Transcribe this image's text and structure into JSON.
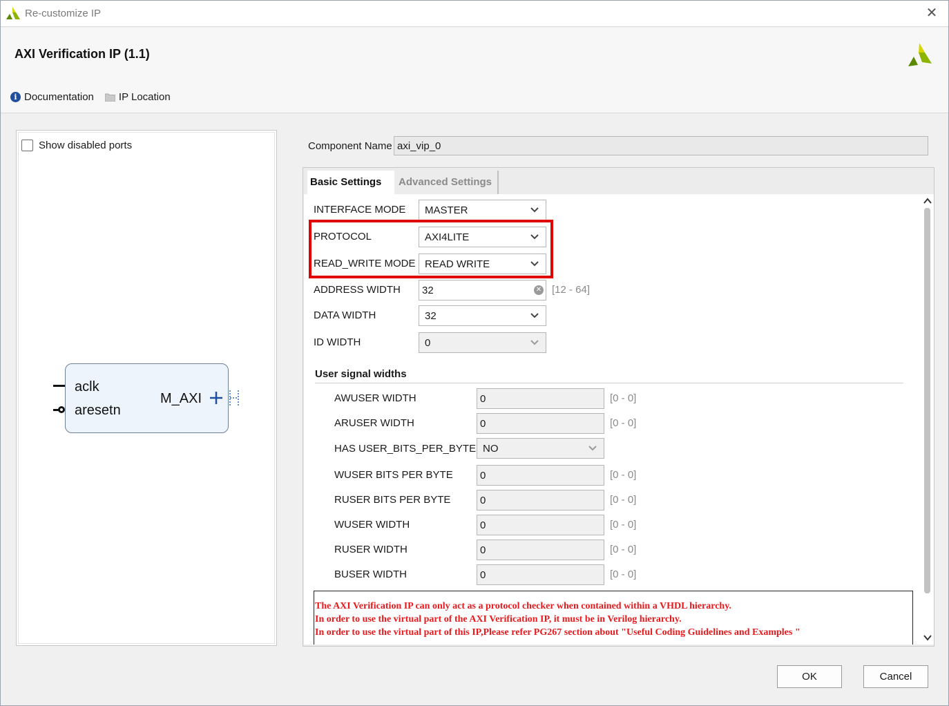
{
  "window": {
    "title": "Re-customize IP",
    "close_glyph": "✕"
  },
  "header": {
    "ip_title": "AXI Verification IP (1.1)",
    "links": [
      {
        "label": "Documentation",
        "icon": "info-icon"
      },
      {
        "label": "IP Location",
        "icon": "folder-icon"
      }
    ]
  },
  "left_panel": {
    "show_disabled_ports_label": "Show disabled ports",
    "show_disabled_ports_checked": false,
    "block": {
      "ports_left": [
        "aclk",
        "aresetn"
      ],
      "ports_right": [
        "M_AXI"
      ]
    }
  },
  "component": {
    "label": "Component Name",
    "value": "axi_vip_0"
  },
  "tabs": [
    {
      "label": "Basic Settings",
      "active": true
    },
    {
      "label": "Advanced Settings",
      "active": false
    }
  ],
  "basic": {
    "interface_mode": {
      "label": "INTERFACE MODE",
      "value": "MASTER"
    },
    "protocol": {
      "label": "PROTOCOL",
      "value": "AXI4LITE"
    },
    "read_write_mode": {
      "label": "READ_WRITE MODE",
      "value": "READ WRITE"
    },
    "address_width": {
      "label": "ADDRESS WIDTH",
      "value": "32",
      "range": "[12 - 64]"
    },
    "data_width": {
      "label": "DATA WIDTH",
      "value": "32"
    },
    "id_width": {
      "label": "ID WIDTH",
      "value": "0"
    }
  },
  "user_signals": {
    "title": "User signal widths",
    "awuser_width": {
      "label": "AWUSER WIDTH",
      "value": "0",
      "range": "[0 - 0]"
    },
    "aruser_width": {
      "label": "ARUSER WIDTH",
      "value": "0",
      "range": "[0 - 0]"
    },
    "has_user_bits_per_byte": {
      "label": "HAS USER_BITS_PER_BYTE",
      "value": "NO"
    },
    "wuser_bits_per_byte": {
      "label": "WUSER BITS PER BYTE",
      "value": "0",
      "range": "[0 - 0]"
    },
    "ruser_bits_per_byte": {
      "label": "RUSER BITS PER BYTE",
      "value": "0",
      "range": "[0 - 0]"
    },
    "wuser_width": {
      "label": "WUSER WIDTH",
      "value": "0",
      "range": "[0 - 0]"
    },
    "ruser_width": {
      "label": "RUSER WIDTH",
      "value": "0",
      "range": "[0 - 0]"
    },
    "buser_width": {
      "label": "BUSER WIDTH",
      "value": "0",
      "range": "[0 - 0]"
    }
  },
  "note": {
    "lines": [
      "The AXI Verification IP can only act as a protocol checker when contained within a VHDL hierarchy.",
      "In order to use the virtual part of the AXI Verification IP, it must be in Verilog hierarchy.",
      "In order to use the virtual part of this IP,Please refer PG267 section about \"Useful Coding Guidelines and Examples \""
    ],
    "color": "#e8191c"
  },
  "buttons": {
    "ok": "OK",
    "cancel": "Cancel"
  },
  "colors": {
    "highlight": "#e00000",
    "brand_green": "#8cb400",
    "brand_yellow": "#d7d500"
  }
}
